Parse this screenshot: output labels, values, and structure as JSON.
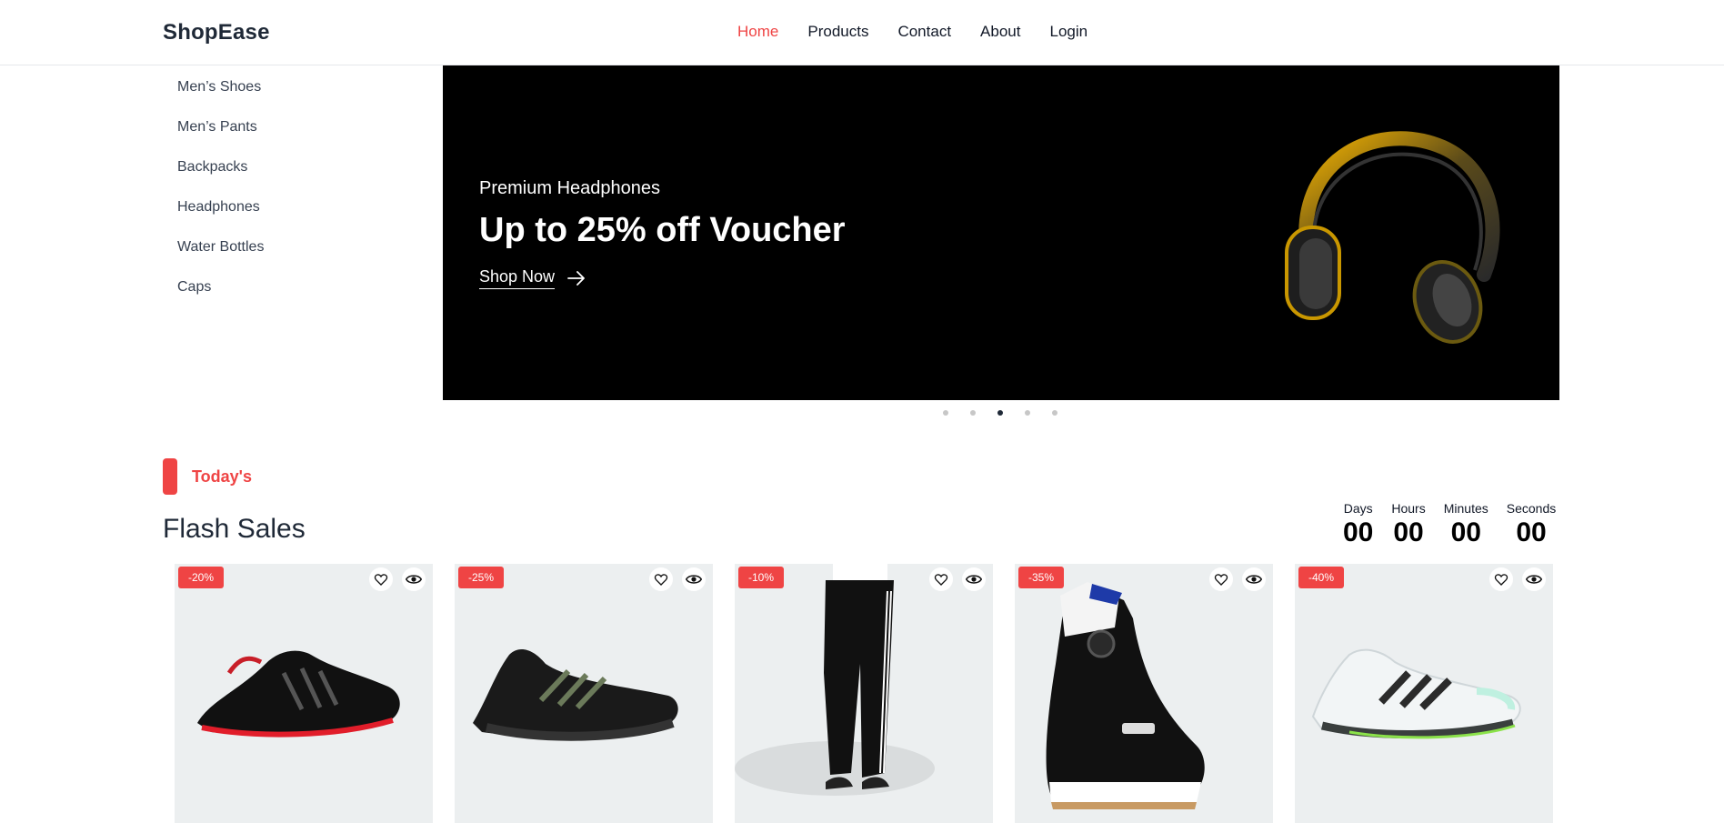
{
  "brand": "ShopEase",
  "nav": [
    {
      "label": "Home",
      "active": true
    },
    {
      "label": "Products",
      "active": false
    },
    {
      "label": "Contact",
      "active": false
    },
    {
      "label": "About",
      "active": false
    },
    {
      "label": "Login",
      "active": false
    }
  ],
  "sidebar": {
    "items": [
      {
        "label": "Men’s Shoes"
      },
      {
        "label": "Men’s Pants"
      },
      {
        "label": "Backpacks"
      },
      {
        "label": "Headphones"
      },
      {
        "label": "Water Bottles"
      },
      {
        "label": "Caps"
      }
    ]
  },
  "hero": {
    "subtitle": "Premium Headphones",
    "title": "Up to 25% off Voucher",
    "cta": "Shop Now",
    "image": "headphones-image",
    "slides": 5,
    "active_slide": 3
  },
  "section": {
    "tag": "Today's",
    "title": "Flash Sales"
  },
  "countdown": [
    {
      "label": "Days",
      "value": "00"
    },
    {
      "label": "Hours",
      "value": "00"
    },
    {
      "label": "Minutes",
      "value": "00"
    },
    {
      "label": "Seconds",
      "value": "00"
    }
  ],
  "products": [
    {
      "discount": "-20%",
      "image": "black-red-sneaker-image"
    },
    {
      "discount": "-25%",
      "image": "black-sneaker-image"
    },
    {
      "discount": "-10%",
      "image": "track-pants-image"
    },
    {
      "discount": "-35%",
      "image": "snowboard-boot-image"
    },
    {
      "discount": "-40%",
      "image": "white-sneaker-image"
    }
  ],
  "colors": {
    "accent": "#ef4444",
    "card_bg": "#eceff0",
    "hero_bg": "#000000"
  }
}
